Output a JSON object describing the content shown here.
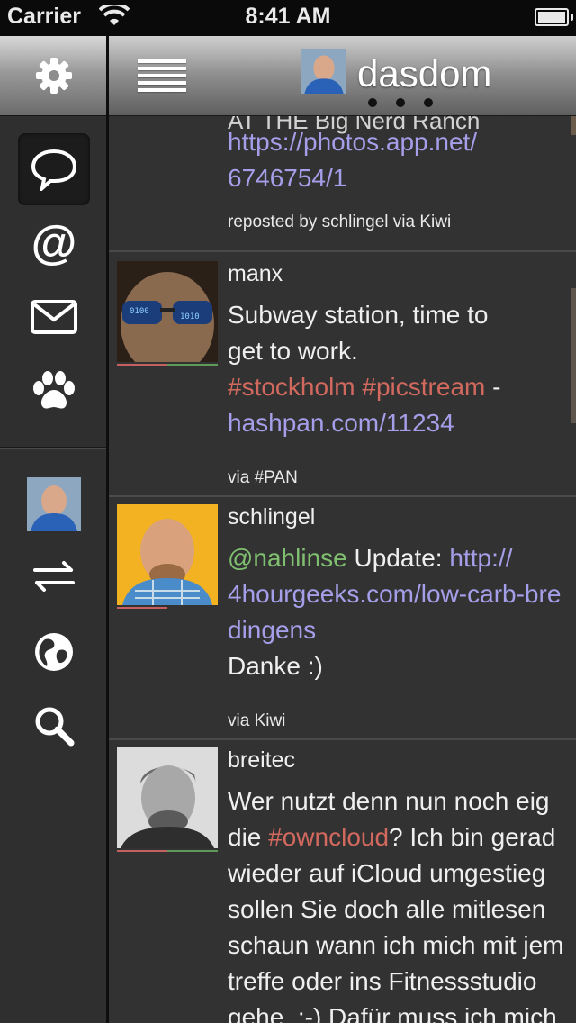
{
  "status_bar": {
    "carrier": "Carrier",
    "time": "8:41 AM"
  },
  "header": {
    "title": "dasdom"
  },
  "sidebar": {
    "items": [
      {
        "name": "timeline",
        "icon": "speech-bubble-icon",
        "active": true
      },
      {
        "name": "mentions",
        "icon": "at-sign-icon"
      },
      {
        "name": "messages",
        "icon": "envelope-icon"
      },
      {
        "name": "patter",
        "icon": "paw-icon"
      },
      {
        "name": "profile",
        "icon": "avatar"
      },
      {
        "name": "interactions",
        "icon": "arrows-swap-icon"
      },
      {
        "name": "global",
        "icon": "globe-icon"
      },
      {
        "name": "search",
        "icon": "search-icon"
      }
    ]
  },
  "posts": [
    {
      "line0": "AT THE Big Nerd Ranch",
      "line1": "https://photos.app.net/",
      "line2": "6746754/1",
      "via": "reposted by schlingel via Kiwi"
    },
    {
      "user": "manx",
      "line1": "Subway station, time to",
      "line2": "get to work.",
      "tag1": "#stockholm",
      "tag2": "#picstream",
      "dash": " -",
      "link": "hashpan.com/11234",
      "via": "via #PAN"
    },
    {
      "user": "schlingel",
      "mention": "@nahlinse",
      "text": " Update: ",
      "link1": "http://",
      "link2": "4hourgeeks.com/low-carb-bre",
      "link3": "dingens",
      "line4": "Danke :)",
      "via": "via Kiwi"
    },
    {
      "user": "breitec",
      "line1": "Wer nutzt denn nun noch eig",
      "line2a": "die ",
      "tag": "#owncloud",
      "line2b": "? Ich bin gerad",
      "line3": "wieder auf iCloud umgestieg",
      "line4": "sollen Sie doch alle mitlesen",
      "line5": "schaun wann ich mich mit jem",
      "line6": "treffe oder ins Fitnessstudio",
      "line7": "gehe. :-) Dafür muss ich mich"
    }
  ],
  "colors": {
    "hashtag": "#d2695e",
    "mention": "#7fbf6f",
    "link": "#a59ee8"
  }
}
